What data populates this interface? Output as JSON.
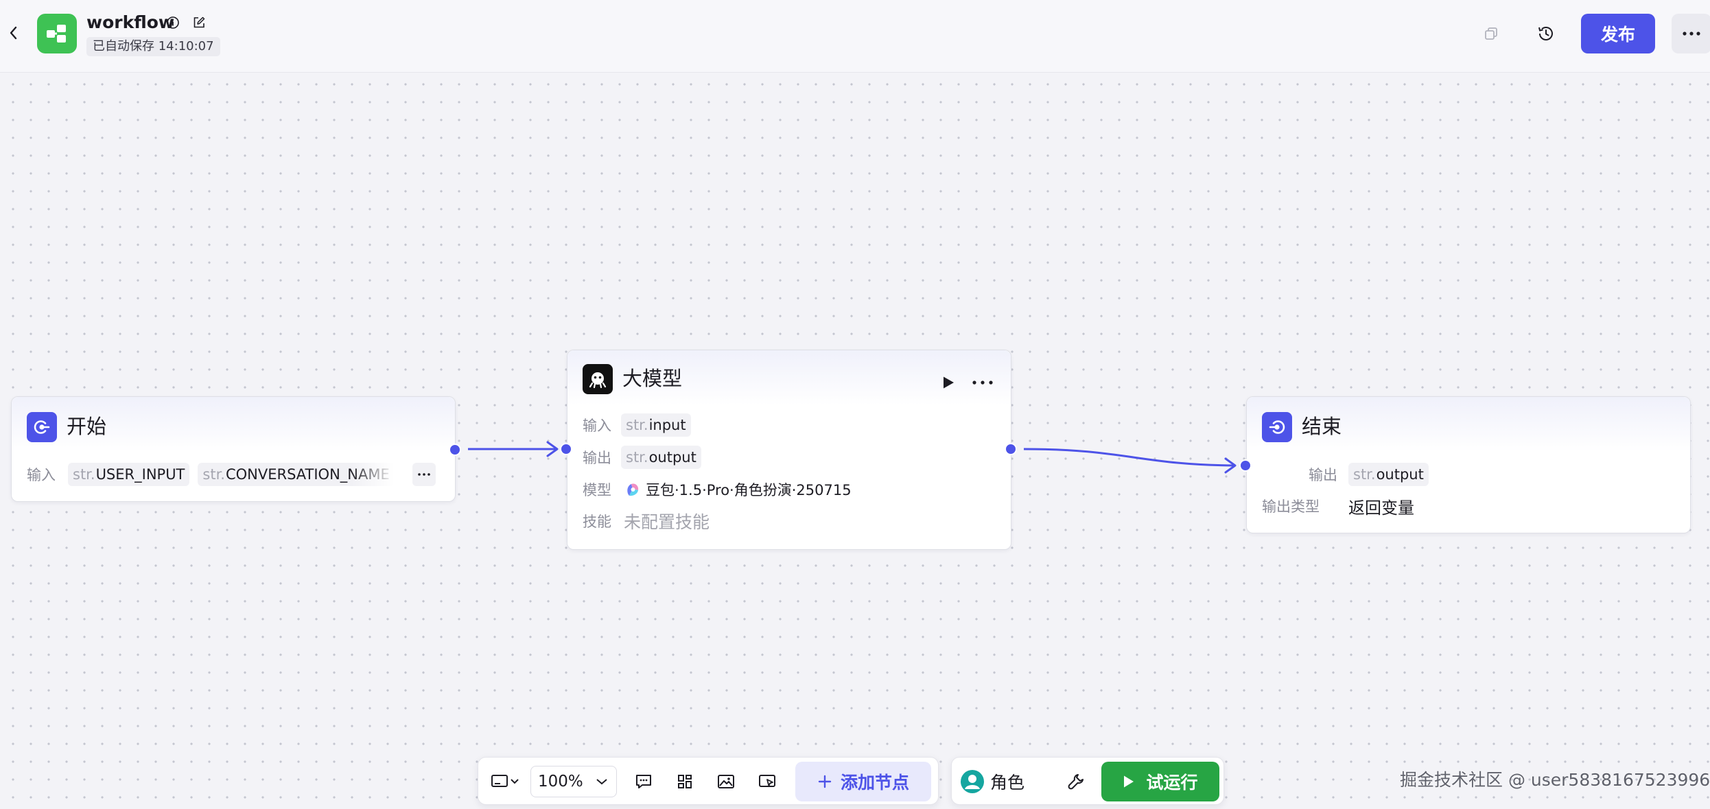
{
  "header": {
    "title": "workflow",
    "autosave": "已自动保存 14:10:07",
    "publish_label": "发布"
  },
  "nodes": {
    "start": {
      "title": "开始",
      "input_label": "输入",
      "params": [
        {
          "type": "str.",
          "name": "USER_INPUT"
        },
        {
          "type": "str.",
          "name": "CONVERSATION_NAME"
        }
      ],
      "icon": "start-icon"
    },
    "llm": {
      "title": "大模型",
      "input_label": "输入",
      "input_type": "str.",
      "input_name": "input",
      "output_label": "输出",
      "output_type": "str.",
      "output_name": "output",
      "model_label": "模型",
      "model_value": "豆包·1.5·Pro·角色扮演·250715",
      "skill_label": "技能",
      "skill_value": "未配置技能",
      "icon": "llm-icon"
    },
    "end": {
      "title": "结束",
      "output_label": "输出",
      "output_type": "str.",
      "output_name": "output",
      "output_type_label": "输出类型",
      "output_type_value": "返回变量",
      "icon": "end-icon"
    }
  },
  "toolbar": {
    "zoom": "100%",
    "add_node_label": "添加节点",
    "role_label": "角色",
    "run_label": "试运行"
  },
  "watermark": "掘金技术社区 @ user5838167523996",
  "colors": {
    "accent": "#4d53e8",
    "run_green": "#27a544",
    "logo_green": "#3ec254"
  }
}
